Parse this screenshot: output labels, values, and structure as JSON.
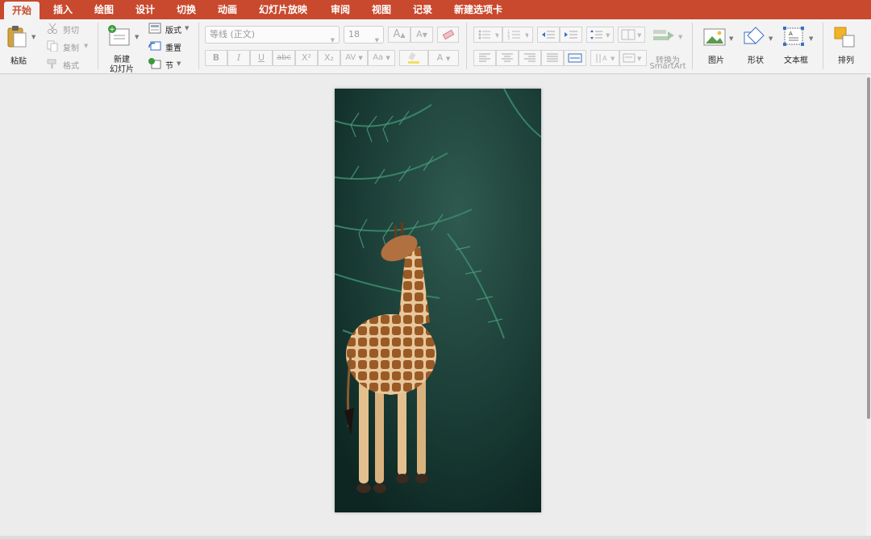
{
  "tabs": [
    {
      "label": "开始",
      "active": true
    },
    {
      "label": "插入"
    },
    {
      "label": "绘图"
    },
    {
      "label": "设计"
    },
    {
      "label": "切换"
    },
    {
      "label": "动画"
    },
    {
      "label": "幻灯片放映"
    },
    {
      "label": "审阅"
    },
    {
      "label": "视图"
    },
    {
      "label": "记录"
    },
    {
      "label": "新建选项卡"
    }
  ],
  "clipboard": {
    "paste": "粘贴",
    "cut": "剪切",
    "copy": "复制",
    "format": "格式"
  },
  "slides": {
    "new_line1": "新建",
    "new_line2": "幻灯片",
    "layout": "版式",
    "reset": "重置",
    "section": "节"
  },
  "font": {
    "name_placeholder": "等线 (正文)",
    "size": "18",
    "grow": "A",
    "shrink": "A",
    "bold": "B",
    "italic": "I",
    "underline": "U",
    "strike": "abc",
    "superscript": "X²",
    "subscript": "X₂",
    "spacing": "AV",
    "case": "Aa",
    "color": "A"
  },
  "paragraph": {
    "smartart_line1": "转换为",
    "smartart_line2": "SmartArt"
  },
  "insert": {
    "picture": "图片",
    "shape": "形状",
    "textbox": "文本框",
    "arrange": "排列"
  },
  "colors": {
    "accent": "#c8492e",
    "ribbon_bg": "#f3f3f3",
    "canvas_bg": "#ececec",
    "slide_bg": "#10302c"
  }
}
